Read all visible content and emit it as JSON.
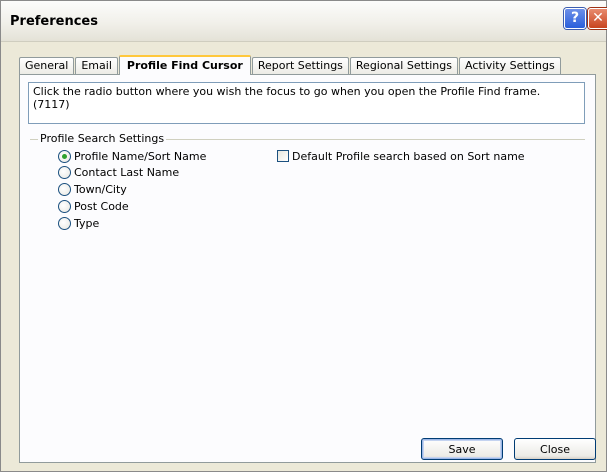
{
  "window": {
    "title": "Preferences",
    "help_glyph": "?",
    "close_glyph": "✕"
  },
  "tabs": [
    {
      "label": "General",
      "active": false
    },
    {
      "label": "Email",
      "active": false
    },
    {
      "label": "Profile Find Cursor",
      "active": true
    },
    {
      "label": "Report Settings",
      "active": false
    },
    {
      "label": "Regional Settings",
      "active": false
    },
    {
      "label": "Activity Settings",
      "active": false
    }
  ],
  "instructions": "Click the radio button where you wish the focus to go when you open the Profile Find frame. (7117)",
  "profile_search": {
    "group_title": "Profile Search Settings",
    "options": [
      {
        "label": "Profile Name/Sort Name",
        "selected": true
      },
      {
        "label": "Contact Last Name",
        "selected": false
      },
      {
        "label": "Town/City",
        "selected": false
      },
      {
        "label": "Post Code",
        "selected": false
      },
      {
        "label": "Type",
        "selected": false
      }
    ],
    "sort_name_checkbox": {
      "label": "Default Profile search based on Sort name",
      "checked": false
    }
  },
  "buttons": {
    "save": "Save",
    "close": "Close"
  },
  "colors": {
    "active_tab_accent": "#ffc83c",
    "selected_radio_dot": "#2fa22f",
    "titlebar_close": "#c8441f",
    "titlebar_help": "#2a5fdb"
  }
}
